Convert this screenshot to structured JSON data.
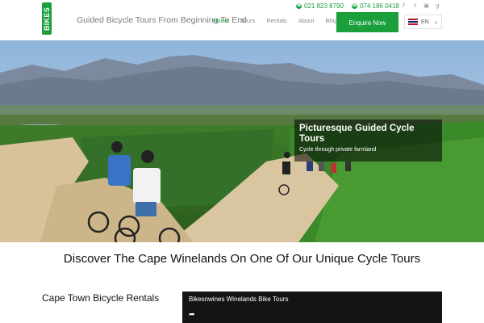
{
  "header": {
    "logo_text": "BIKES",
    "tagline": "Guided Bicycle Tours From Beginning To End",
    "nav": [
      "Home",
      "Tours",
      "Rentals",
      "About",
      "Blog"
    ],
    "phones": [
      "021 823 8790",
      "074 186 0418"
    ],
    "social_icons": [
      "facebook-icon",
      "twitter-icon",
      "instagram-icon",
      "google-plus-icon"
    ],
    "enquire_label": "Enquire Now",
    "language": "EN",
    "accent_color": "#1a9f3b"
  },
  "hero": {
    "caption_title": "Picturesque Guided Cycle Tours",
    "caption_subtitle": "Cycle through private farmland"
  },
  "main": {
    "headline": "Discover The Cape Winelands On One Of Our Unique Cycle Tours",
    "rentals_title": "Cape Town Bicycle Rentals",
    "video_title": "Bikesnwines Winelands Bike Tours"
  }
}
